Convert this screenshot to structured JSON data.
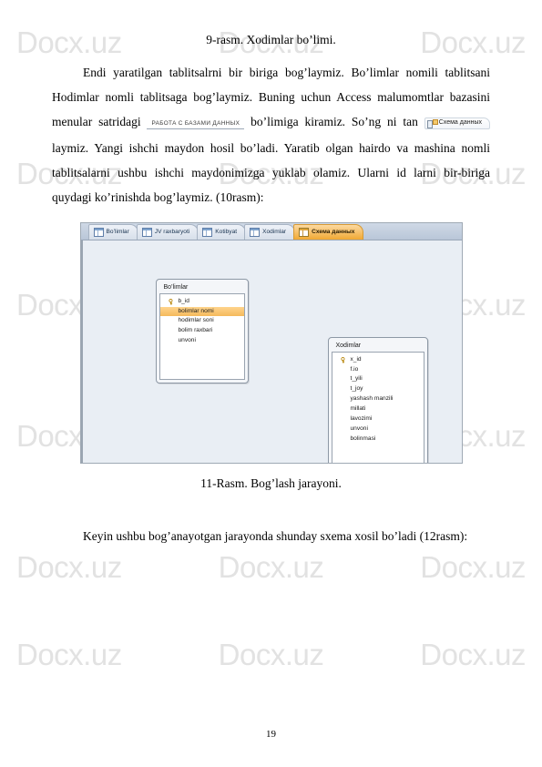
{
  "document": {
    "page_number": "19",
    "watermark_text": "Docx.uz"
  },
  "figure_caption_top": "9-rasm. Xodimlar bo’limi.",
  "paragraph_1": {
    "seg_a": "Endi yaratilgan tablitsalrni bir biriga bog’laymiz. Bo’limlar nomili tablitsani Hodimlar nomli tablitsaga bog’laymiz. Buning uchun Access malumomtlar bazasini menular satridagi",
    "ribbon_group_label": "РАБОТА С БАЗАМИ ДАННЫХ",
    "seg_b": "bo’limiga kiramiz. So’ng ni tan",
    "ribbon_button_label": "Схема данных",
    "seg_c": "laymiz. Yangi ishchi maydon hosil bo’ladi. Yaratib olgan hairdo va mashina nomli tablitsalarni ushbu ishchi maydonimizga yuklab olamiz. Ularni id larni bir-biriga quydagi ko’rinishda bog’laymiz. (10rasm):"
  },
  "screenshot": {
    "tabs": [
      {
        "label": "Bo’limlar",
        "icon": "table-icon",
        "active": false
      },
      {
        "label": "JV raxbaryoti",
        "icon": "table-icon",
        "active": false
      },
      {
        "label": "Kotibyat",
        "icon": "table-icon",
        "active": false
      },
      {
        "label": "Xodimlar",
        "icon": "table-icon",
        "active": false
      },
      {
        "label": "Схема данных",
        "icon": "relationships-icon",
        "active": true
      }
    ],
    "tables": [
      {
        "name": "Bo’limlar",
        "fields": [
          {
            "label": "b_id",
            "primary_key": true,
            "selected": false
          },
          {
            "label": "bolimlar nomi",
            "primary_key": false,
            "selected": true
          },
          {
            "label": "hodimlar soni",
            "primary_key": false,
            "selected": false
          },
          {
            "label": "bolim raxbari",
            "primary_key": false,
            "selected": false
          },
          {
            "label": "unvoni",
            "primary_key": false,
            "selected": false
          }
        ]
      },
      {
        "name": "Xodimlar",
        "fields": [
          {
            "label": "x_id",
            "primary_key": true,
            "selected": false
          },
          {
            "label": "f.io",
            "primary_key": false,
            "selected": false
          },
          {
            "label": "t_yili",
            "primary_key": false,
            "selected": false
          },
          {
            "label": "t_joy",
            "primary_key": false,
            "selected": false
          },
          {
            "label": "yashash manzili",
            "primary_key": false,
            "selected": false
          },
          {
            "label": "millati",
            "primary_key": false,
            "selected": false
          },
          {
            "label": "lavozimi",
            "primary_key": false,
            "selected": false
          },
          {
            "label": "unvoni",
            "primary_key": false,
            "selected": false
          },
          {
            "label": "bolinmasi",
            "primary_key": false,
            "selected": false
          }
        ]
      }
    ],
    "colors": {
      "active_tab": "#f0a833",
      "selected_field": "#f5b95c",
      "canvas": "#e9eef4"
    }
  },
  "figure_caption_bottom": "11-Rasm. Bog’lash jarayoni.",
  "paragraph_2": "Keyin ushbu bog’anayotgan jarayonda shunday sxema xosil bo’ladi (12rasm):"
}
